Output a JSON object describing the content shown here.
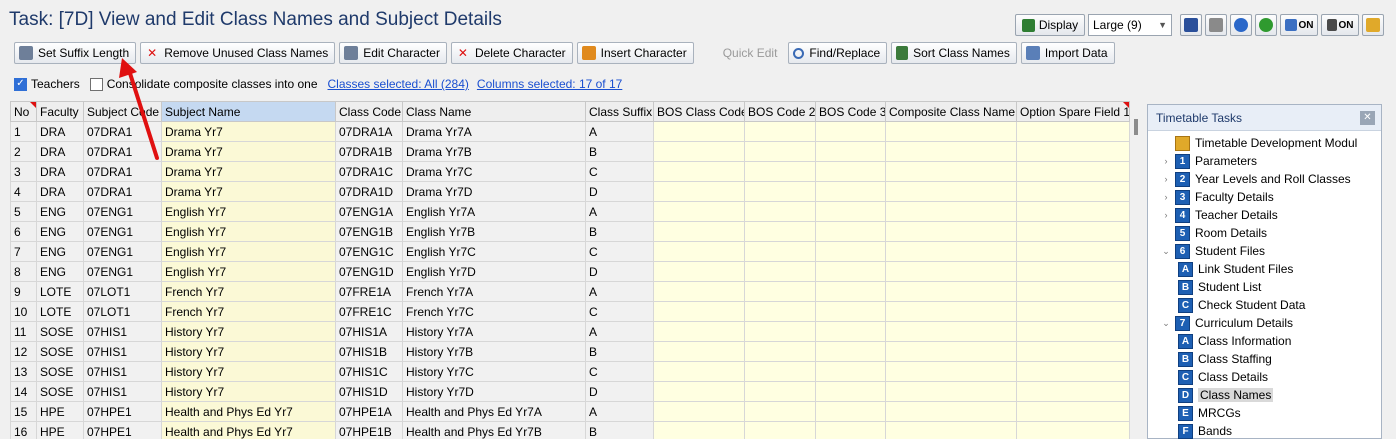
{
  "title": "Task: [7D] View and Edit Class Names and Subject Details",
  "topbar": {
    "display_label": "Display",
    "size_value": "Large (9)",
    "on1": "ON",
    "on2": "ON"
  },
  "toolbar": {
    "set_suffix": "Set Suffix Length",
    "remove_unused": "Remove Unused Class Names",
    "edit_char": "Edit Character",
    "delete_char": "Delete Character",
    "insert_char": "Insert Character",
    "quick_edit": "Quick Edit",
    "find_replace": "Find/Replace",
    "sort_names": "Sort Class Names",
    "import_data": "Import Data"
  },
  "options": {
    "teachers": "Teachers",
    "consolidate": "Consolidate composite classes into one",
    "classes_selected": "Classes selected: All (284)",
    "columns_selected": "Columns selected: 17 of 17"
  },
  "grid": {
    "headers": [
      "No",
      "Faculty",
      "Subject Code",
      "Subject Name",
      "Class Code",
      "Class Name",
      "Class Suffix",
      "BOS Class Code",
      "BOS Code 2",
      "BOS Code 3",
      "Composite Class Name",
      "Option Spare Field 1"
    ],
    "rows": [
      [
        "1",
        "DRA",
        "07DRA1",
        "Drama Yr7",
        "07DRA1A",
        "Drama Yr7A",
        "A"
      ],
      [
        "2",
        "DRA",
        "07DRA1",
        "Drama Yr7",
        "07DRA1B",
        "Drama Yr7B",
        "B"
      ],
      [
        "3",
        "DRA",
        "07DRA1",
        "Drama Yr7",
        "07DRA1C",
        "Drama Yr7C",
        "C"
      ],
      [
        "4",
        "DRA",
        "07DRA1",
        "Drama Yr7",
        "07DRA1D",
        "Drama Yr7D",
        "D"
      ],
      [
        "5",
        "ENG",
        "07ENG1",
        "English Yr7",
        "07ENG1A",
        "English Yr7A",
        "A"
      ],
      [
        "6",
        "ENG",
        "07ENG1",
        "English Yr7",
        "07ENG1B",
        "English Yr7B",
        "B"
      ],
      [
        "7",
        "ENG",
        "07ENG1",
        "English Yr7",
        "07ENG1C",
        "English Yr7C",
        "C"
      ],
      [
        "8",
        "ENG",
        "07ENG1",
        "English Yr7",
        "07ENG1D",
        "English Yr7D",
        "D"
      ],
      [
        "9",
        "LOTE",
        "07LOT1",
        "French Yr7",
        "07FRE1A",
        "French Yr7A",
        "A"
      ],
      [
        "10",
        "LOTE",
        "07LOT1",
        "French Yr7",
        "07FRE1C",
        "French Yr7C",
        "C"
      ],
      [
        "11",
        "SOSE",
        "07HIS1",
        "History Yr7",
        "07HIS1A",
        "History Yr7A",
        "A"
      ],
      [
        "12",
        "SOSE",
        "07HIS1",
        "History Yr7",
        "07HIS1B",
        "History Yr7B",
        "B"
      ],
      [
        "13",
        "SOSE",
        "07HIS1",
        "History Yr7",
        "07HIS1C",
        "History Yr7C",
        "C"
      ],
      [
        "14",
        "SOSE",
        "07HIS1",
        "History Yr7",
        "07HIS1D",
        "History Yr7D",
        "D"
      ],
      [
        "15",
        "HPE",
        "07HPE1",
        "Health and Phys Ed Yr7",
        "07HPE1A",
        "Health and Phys Ed Yr7A",
        "A"
      ],
      [
        "16",
        "HPE",
        "07HPE1",
        "Health and Phys Ed Yr7",
        "07HPE1B",
        "Health and Phys Ed Yr7B",
        "B"
      ]
    ]
  },
  "panel": {
    "title": "Timetable Tasks",
    "items": [
      {
        "badge": "",
        "label": "Timetable Development Modul",
        "chev": "",
        "indent": 0,
        "icon": "house"
      },
      {
        "badge": "1",
        "label": "Parameters",
        "chev": "›",
        "indent": 0
      },
      {
        "badge": "2",
        "label": "Year Levels and Roll Classes",
        "chev": "›",
        "indent": 0
      },
      {
        "badge": "3",
        "label": "Faculty Details",
        "chev": "›",
        "indent": 0
      },
      {
        "badge": "4",
        "label": "Teacher Details",
        "chev": "›",
        "indent": 0
      },
      {
        "badge": "5",
        "label": "Room Details",
        "chev": "",
        "indent": 0
      },
      {
        "badge": "6",
        "label": "Student Files",
        "chev": "⌄",
        "indent": 0
      },
      {
        "badge": "A",
        "label": "Link Student Files",
        "chev": "",
        "indent": 1
      },
      {
        "badge": "B",
        "label": "Student List",
        "chev": "",
        "indent": 1
      },
      {
        "badge": "C",
        "label": "Check Student Data",
        "chev": "",
        "indent": 1
      },
      {
        "badge": "7",
        "label": "Curriculum Details",
        "chev": "⌄",
        "indent": 0
      },
      {
        "badge": "A",
        "label": "Class Information",
        "chev": "",
        "indent": 1
      },
      {
        "badge": "B",
        "label": "Class Staffing",
        "chev": "",
        "indent": 1
      },
      {
        "badge": "C",
        "label": "Class Details",
        "chev": "",
        "indent": 1
      },
      {
        "badge": "D",
        "label": "Class Names",
        "chev": "",
        "indent": 1,
        "selected": true
      },
      {
        "badge": "E",
        "label": "MRCGs",
        "chev": "",
        "indent": 1
      },
      {
        "badge": "F",
        "label": "Bands",
        "chev": "",
        "indent": 1
      }
    ]
  },
  "colors": {
    "accent": "#1d5fb3",
    "title": "#1f3a6b",
    "editable": "#ffffe1",
    "annotation": "#e01010"
  }
}
